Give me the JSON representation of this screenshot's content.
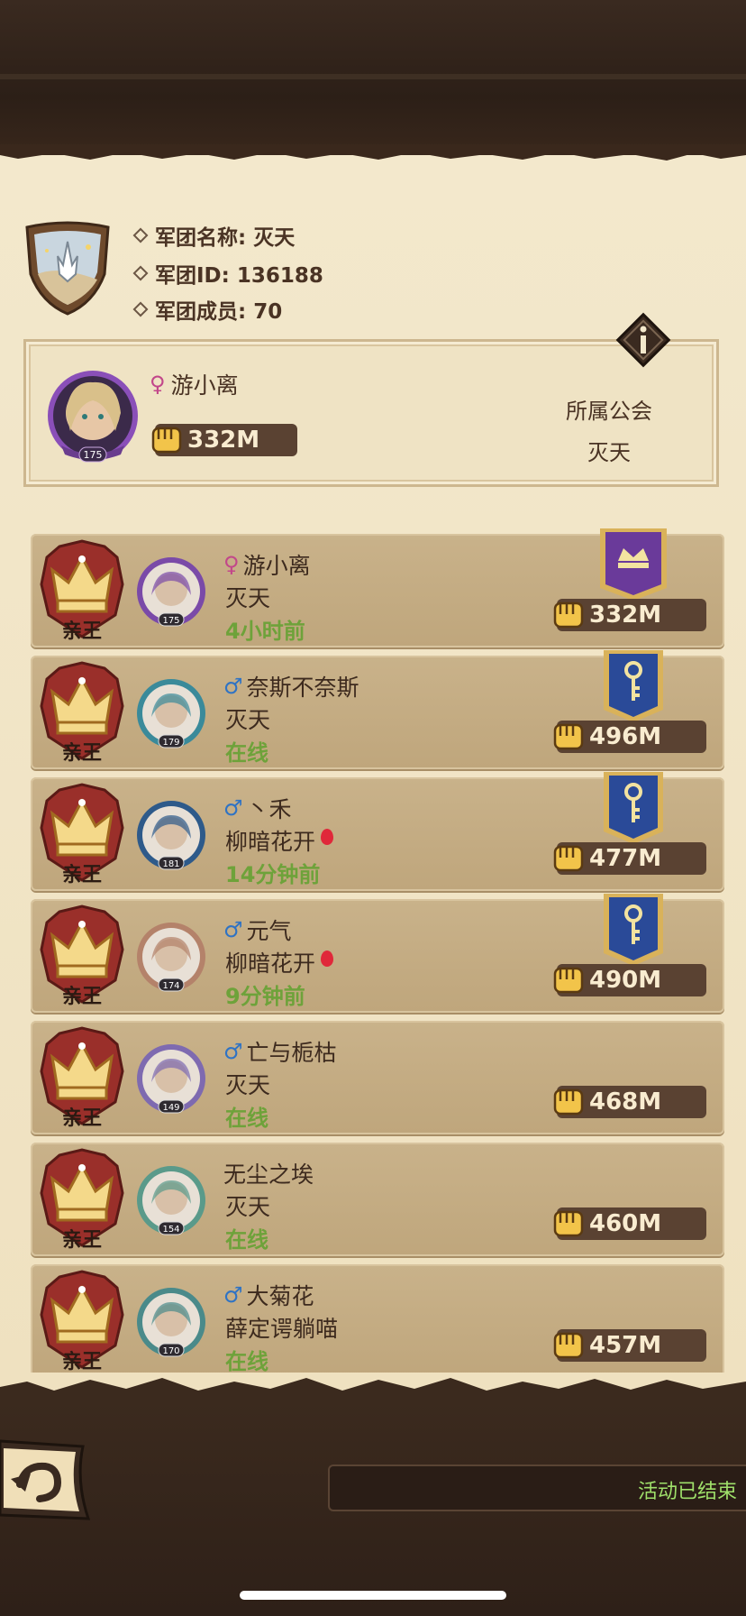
{
  "guild": {
    "name_line": "军团名称: 灭天",
    "id_line": "军团ID: 136188",
    "members_line": "军团成员: 70"
  },
  "leader": {
    "gender": "♀",
    "name": "游小离",
    "level": "175",
    "power": "332M",
    "guild_label": "所属公会",
    "guild_name": "灭天"
  },
  "rows": [
    {
      "rank": "亲王",
      "gender": "♀",
      "gender_type": "female",
      "name": "游小离",
      "guild": "灭天",
      "status": "4小时前",
      "level": "175",
      "power": "332M",
      "banner": "purple-crown",
      "balloon": false
    },
    {
      "rank": "亲王",
      "gender": "♂",
      "gender_type": "male",
      "name": "奈斯不奈斯",
      "guild": "灭天",
      "status": "在线",
      "level": "179",
      "power": "496M",
      "banner": "blue-key",
      "balloon": false
    },
    {
      "rank": "亲王",
      "gender": "♂",
      "gender_type": "male",
      "name": "丶禾",
      "guild": "柳暗花开",
      "status": "14分钟前",
      "level": "181",
      "power": "477M",
      "banner": "blue-key",
      "balloon": true
    },
    {
      "rank": "亲王",
      "gender": "♂",
      "gender_type": "male",
      "name": "元气",
      "guild": "柳暗花开",
      "status": "9分钟前",
      "level": "174",
      "power": "490M",
      "banner": "blue-key",
      "balloon": true
    },
    {
      "rank": "亲王",
      "gender": "♂",
      "gender_type": "male",
      "name": "亡与栀枯",
      "guild": "灭天",
      "status": "在线",
      "level": "149",
      "power": "468M",
      "banner": "",
      "balloon": false
    },
    {
      "rank": "亲王",
      "gender": "",
      "gender_type": "",
      "name": "无尘之埃",
      "guild": "灭天",
      "status": "在线",
      "level": "154",
      "power": "460M",
      "banner": "",
      "balloon": false
    },
    {
      "rank": "亲王",
      "gender": "♂",
      "gender_type": "male",
      "name": "大菊花",
      "guild": "薛定谔躺喵",
      "status": "在线",
      "level": "170",
      "power": "457M",
      "banner": "",
      "balloon": false
    }
  ],
  "footer": {
    "event_status": "活动已结束"
  },
  "colors": {
    "online_green": "#6ea23a",
    "female": "#c2478a",
    "male": "#2f73c4",
    "parchment": "#f0e3c4",
    "dark_wood": "#2e2018"
  }
}
